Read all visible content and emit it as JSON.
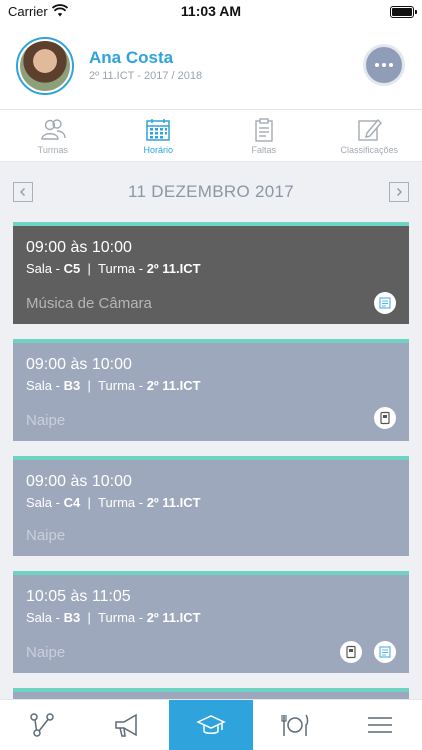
{
  "status_bar": {
    "carrier": "Carrier",
    "time": "11:03 AM"
  },
  "profile": {
    "name": "Ana Costa",
    "subtitle": "2º 11.ICT - 2017 / 2018"
  },
  "tabs": [
    {
      "label": "Turmas",
      "icon": "people-icon",
      "active": false
    },
    {
      "label": "Horário",
      "icon": "calendar-icon",
      "active": true
    },
    {
      "label": "Faltas",
      "icon": "clipboard-icon",
      "active": false
    },
    {
      "label": "Classificações",
      "icon": "edit-icon",
      "active": false
    }
  ],
  "date_nav": {
    "date": "11 DEZEMBRO 2017"
  },
  "schedule": [
    {
      "time": "09:00 às 10:00",
      "room_label": "Sala -",
      "room": "C5",
      "class_label": "Turma -",
      "class": "2º 11.ICT",
      "subject": "Música de Câmara",
      "highlighted": true,
      "icons": [
        "lesson-summary-icon"
      ]
    },
    {
      "time": "09:00 às 10:00",
      "room_label": "Sala -",
      "room": "B3",
      "class_label": "Turma -",
      "class": "2º 11.ICT",
      "subject": "Naipe",
      "highlighted": false,
      "icons": [
        "document-icon"
      ]
    },
    {
      "time": "09:00 às 10:00",
      "room_label": "Sala -",
      "room": "C4",
      "class_label": "Turma -",
      "class": "2º 11.ICT",
      "subject": "Naipe",
      "highlighted": false,
      "icons": []
    },
    {
      "time": "10:05 às 11:05",
      "room_label": "Sala -",
      "room": "B3",
      "class_label": "Turma -",
      "class": "2º 11.ICT",
      "subject": "Naipe",
      "highlighted": false,
      "icons": [
        "document-icon",
        "lesson-summary-icon"
      ]
    }
  ],
  "bottom_nav": [
    {
      "icon": "share-graph-icon",
      "active": false
    },
    {
      "icon": "megaphone-icon",
      "active": false
    },
    {
      "icon": "graduation-cap-icon",
      "active": true
    },
    {
      "icon": "cutlery-icon",
      "active": false
    },
    {
      "icon": "menu-icon",
      "active": false
    }
  ],
  "colors": {
    "accent": "#2ea3dc",
    "card": "#9ea8bc",
    "card_highlight": "#5f5f5f",
    "card_top_border": "#6ed3c3"
  }
}
